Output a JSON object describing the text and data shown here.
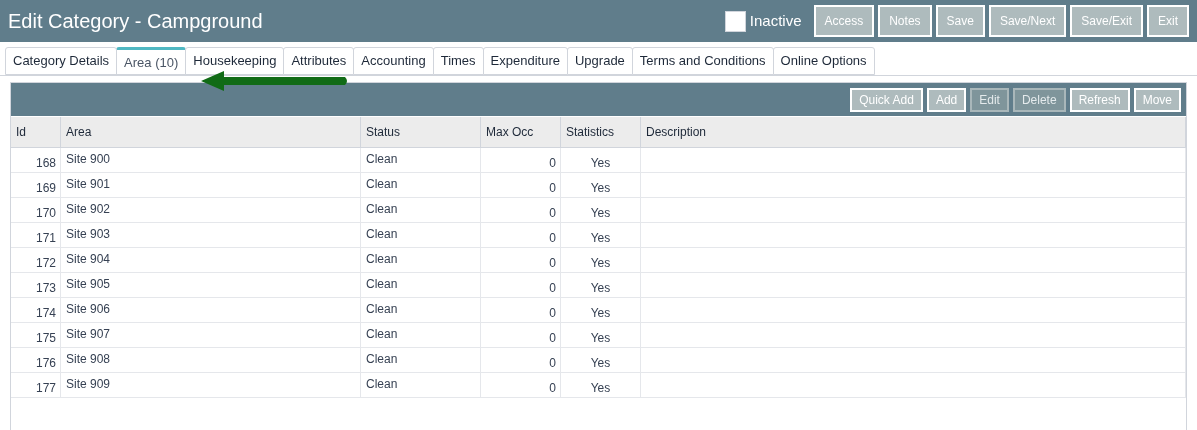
{
  "header": {
    "title": "Edit Category - Campground",
    "inactive": {
      "label": "Inactive",
      "checked": false
    },
    "buttons": [
      {
        "label": "Access"
      },
      {
        "label": "Notes"
      },
      {
        "label": "Save"
      },
      {
        "label": "Save/Next"
      },
      {
        "label": "Save/Exit"
      },
      {
        "label": "Exit"
      }
    ]
  },
  "tabs": [
    {
      "label": "Category Details",
      "selected": false
    },
    {
      "label": "Area (10)",
      "selected": true
    },
    {
      "label": "Housekeeping",
      "selected": false
    },
    {
      "label": "Attributes",
      "selected": false
    },
    {
      "label": "Accounting",
      "selected": false
    },
    {
      "label": "Times",
      "selected": false
    },
    {
      "label": "Expenditure",
      "selected": false
    },
    {
      "label": "Upgrade",
      "selected": false
    },
    {
      "label": "Terms and Conditions",
      "selected": false
    },
    {
      "label": "Online Options",
      "selected": false
    }
  ],
  "toolbar": [
    {
      "label": "Quick Add",
      "disabled": false
    },
    {
      "label": "Add",
      "disabled": false
    },
    {
      "label": "Edit",
      "disabled": true
    },
    {
      "label": "Delete",
      "disabled": true
    },
    {
      "label": "Refresh",
      "disabled": false
    },
    {
      "label": "Move",
      "disabled": false
    }
  ],
  "table": {
    "columns": [
      "Id",
      "Area",
      "Status",
      "Max Occ",
      "Statistics",
      "Description"
    ],
    "rows": [
      [
        "168",
        "Site 900",
        "Clean",
        "0",
        "Yes"
      ],
      [
        "169",
        "Site 901",
        "Clean",
        "0",
        "Yes"
      ],
      [
        "170",
        "Site 902",
        "Clean",
        "0",
        "Yes"
      ],
      [
        "171",
        "Site 903",
        "Clean",
        "0",
        "Yes"
      ],
      [
        "172",
        "Site 904",
        "Clean",
        "0",
        "Yes"
      ],
      [
        "173",
        "Site 905",
        "Clean",
        "0",
        "Yes"
      ],
      [
        "174",
        "Site 906",
        "Clean",
        "0",
        "Yes"
      ],
      [
        "175",
        "Site 907",
        "Clean",
        "0",
        "Yes"
      ],
      [
        "176",
        "Site 908",
        "Clean",
        "0",
        "Yes"
      ],
      [
        "177",
        "Site 909",
        "Clean",
        "0",
        "Yes"
      ]
    ]
  }
}
